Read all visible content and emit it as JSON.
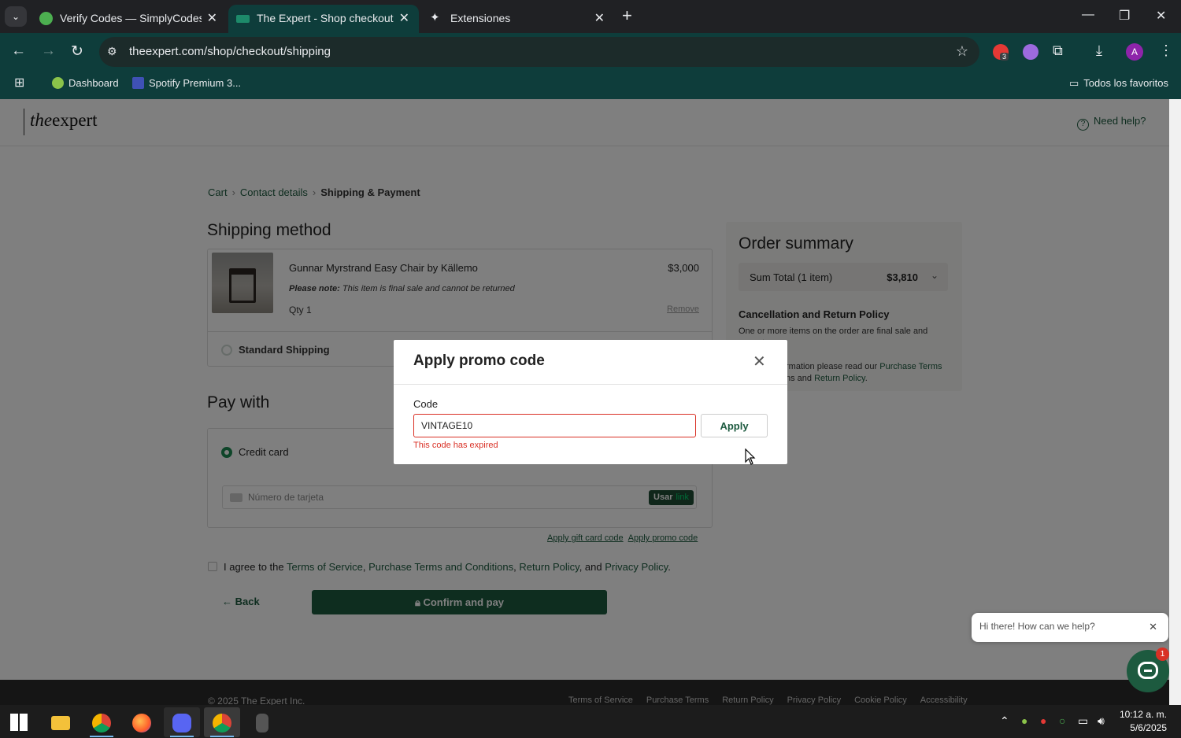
{
  "browser": {
    "tabs": [
      {
        "title": "Verify Codes — SimplyCodes",
        "active": false
      },
      {
        "title": "The Expert - Shop checkout - Sh",
        "active": true
      },
      {
        "title": "Extensiones",
        "active": false
      }
    ],
    "url": "theexpert.com/shop/checkout/shipping",
    "bookmarks": [
      "Dashboard",
      "Spotify Premium 3..."
    ],
    "all_bookmarks": "Todos los favoritos",
    "avatar_letter": "A",
    "ext_badge": "3"
  },
  "site": {
    "logo_the": "the",
    "logo_expert": "expert",
    "help": "Need help?"
  },
  "breadcrumb": {
    "cart": "Cart",
    "contact": "Contact details",
    "current": "Shipping & Payment"
  },
  "shipping": {
    "heading": "Shipping method",
    "item_name": "Gunnar Myrstrand Easy Chair by Källemo",
    "item_price": "$3,000",
    "note_label": "Please note:",
    "note_text": "This item is final sale and cannot be returned",
    "qty": "Qty 1",
    "remove": "Remove",
    "option": "Standard Shipping"
  },
  "payment": {
    "heading": "Pay with",
    "method": "Credit card",
    "card_placeholder": "Número de tarjeta",
    "link_use": "Usar",
    "link_brand": "link",
    "gift": "Apply gift card code",
    "promo": "Apply promo code"
  },
  "agree": {
    "prefix": "I agree to the",
    "tos": "Terms of Service",
    "c1": ",",
    "pt": "Purchase Terms and Conditions",
    "c2": ",",
    "rp": "Return Policy",
    "and": ", and",
    "pp": "Privacy Policy",
    "end": "."
  },
  "actions": {
    "back": "Back",
    "confirm": "Confirm and pay"
  },
  "summary": {
    "title": "Order summary",
    "total_label": "Sum Total (1 item)",
    "total": "$3,810",
    "policy_title": "Cancellation and Return Policy",
    "policy_line1": "One or more items on the order are final sale and cannot",
    "policy_line2_tail": "rmation please read our",
    "purchase_terms": "Purchase Terms",
    "policy_line3_head": "ns and",
    "return_policy": "Return Policy",
    "policy_end": "."
  },
  "footer": {
    "copyright": "© 2025 The Expert Inc.",
    "links": [
      "Terms of Service",
      "Purchase Terms",
      "Return Policy",
      "Privacy Policy",
      "Cookie Policy",
      "Accessibility"
    ]
  },
  "chat": {
    "greeting": "Hi there! How can we help?",
    "badge": "1"
  },
  "modal": {
    "title": "Apply promo code",
    "code_label": "Code",
    "code_value": "VINTAGE10",
    "apply": "Apply",
    "error": "This code has expired"
  },
  "taskbar": {
    "time": "10:12 a. m.",
    "date": "5/6/2025"
  },
  "colors": {
    "brand": "#1d5a3f",
    "error": "#d93025",
    "browser_tab": "#0e3d3b"
  },
  "icons": [
    "tab-search-icon",
    "simplycodes-icon",
    "theexpert-icon",
    "extension-puzzle-icon",
    "back-icon",
    "forward-icon",
    "reload-icon",
    "site-info-icon",
    "star-icon",
    "download-icon",
    "menu-icon",
    "apps-icon",
    "folder-icon",
    "help-icon",
    "lock-icon",
    "close-icon",
    "chat-icon",
    "windows-icon"
  ]
}
